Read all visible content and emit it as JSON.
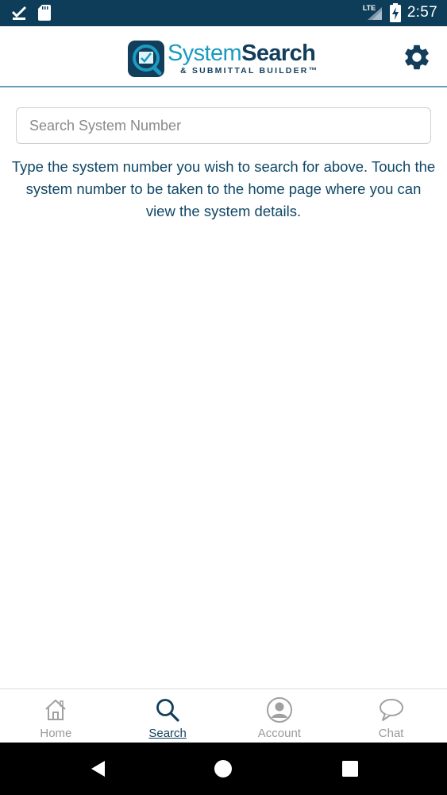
{
  "status_bar": {
    "time": "2:57",
    "network": "LTE",
    "icons": [
      "checkmark-icon",
      "sd-card-icon",
      "signal-icon",
      "battery-charging-icon"
    ]
  },
  "header": {
    "logo_title_light": "System",
    "logo_title_bold": "Search",
    "logo_subtitle": "& SUBMITTAL BUILDER™",
    "settings_icon": "gear-icon"
  },
  "search": {
    "placeholder": "Search System Number",
    "value": "",
    "instructions": "Type the system number you wish to search for above. Touch the system number to be taken to the home page where you can view the system details."
  },
  "bottom_nav": {
    "items": [
      {
        "label": "Home",
        "icon": "home-icon",
        "active": false
      },
      {
        "label": "Search",
        "icon": "search-icon",
        "active": true
      },
      {
        "label": "Account",
        "icon": "account-icon",
        "active": false
      },
      {
        "label": "Chat",
        "icon": "chat-icon",
        "active": false
      }
    ]
  },
  "system_nav": {
    "buttons": [
      "back-icon",
      "home-circle-icon",
      "recents-icon"
    ]
  },
  "colors": {
    "status_bar": "#0d3d59",
    "brand_dark": "#123e5b",
    "brand_light": "#1b9bc1",
    "text": "#0f4766",
    "inactive": "#9a9a9a"
  }
}
